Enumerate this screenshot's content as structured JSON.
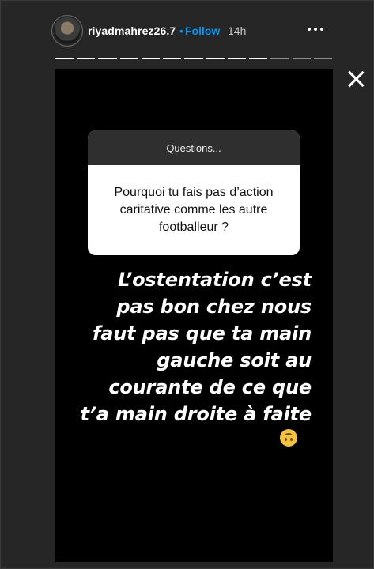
{
  "header": {
    "username": "riyadmahrez26.7",
    "separator": "•",
    "follow_label": "Follow",
    "time": "14h"
  },
  "progress": {
    "segments_total": 13,
    "segments_viewed": 10
  },
  "icons": {
    "avatar": "profile-avatar",
    "more": "more-horizontal-icon",
    "close": "close-icon",
    "emoji": "upside-down-face-emoji"
  },
  "story": {
    "question_title": "Questions...",
    "question_text": "Pourquoi tu fais pas d’action caritative comme les autre footballeur ?",
    "reply_lines": [
      "L’ostentation c’est",
      "pas bon chez nous",
      "faut pas que ta main",
      "gauche soit au",
      "courante de ce que",
      "t’a main droite à faite"
    ]
  },
  "colors": {
    "accent": "#0095f6",
    "background": "#262626",
    "story_bg": "#000000",
    "question_header": "#2f2f2f"
  }
}
